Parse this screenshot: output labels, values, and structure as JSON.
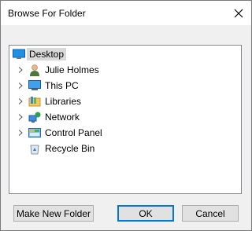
{
  "dialog": {
    "title": "Browse For Folder",
    "close_label": "×"
  },
  "tree": {
    "root": {
      "label": "Desktop",
      "icon": "desktop-icon",
      "selected": true
    },
    "items": [
      {
        "label": "Julie Holmes",
        "icon": "user-icon",
        "expandable": true
      },
      {
        "label": "This PC",
        "icon": "computer-icon",
        "expandable": true
      },
      {
        "label": "Libraries",
        "icon": "libraries-icon",
        "expandable": true
      },
      {
        "label": "Network",
        "icon": "network-icon",
        "expandable": true
      },
      {
        "label": "Control Panel",
        "icon": "control-panel-icon",
        "expandable": true
      },
      {
        "label": "Recycle Bin",
        "icon": "recycle-bin-icon",
        "expandable": false
      }
    ]
  },
  "buttons": {
    "new_folder": "Make New Folder",
    "ok": "OK",
    "cancel": "Cancel"
  },
  "colors": {
    "selection": "#d9d9d9",
    "default_button_border": "#0078d7"
  }
}
